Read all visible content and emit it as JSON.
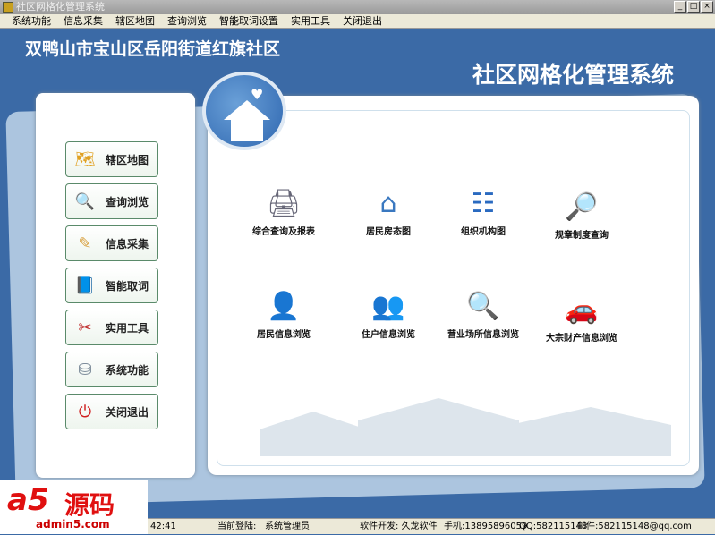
{
  "window": {
    "title": "社区网格化管理系统",
    "controls": [
      "_",
      "□",
      "×"
    ]
  },
  "menu": [
    "系统功能",
    "信息采集",
    "辖区地图",
    "查询浏览",
    "智能取词设置",
    "实用工具",
    "关闭退出"
  ],
  "header": {
    "community": "双鸭山市宝山区岳阳街道红旗社区",
    "system_title": "社区网格化管理系统"
  },
  "nav": [
    {
      "label": "辖区地图",
      "icon": "china-map-icon",
      "color": "#e0a020"
    },
    {
      "label": "查询浏览",
      "icon": "magnifier-document-icon",
      "color": "#3a7ac8"
    },
    {
      "label": "信息采集",
      "icon": "notebook-pencil-icon",
      "color": "#d8a040"
    },
    {
      "label": "智能取词",
      "icon": "book-magnifier-icon",
      "color": "#2a8a6a"
    },
    {
      "label": "实用工具",
      "icon": "tools-icon",
      "color": "#c03030"
    },
    {
      "label": "系统功能",
      "icon": "database-gear-icon",
      "color": "#708090"
    },
    {
      "label": "关闭退出",
      "icon": "power-icon",
      "color": "#d02020"
    }
  ],
  "functions": [
    {
      "label": "综合查询及报表",
      "icon": "printer-icon"
    },
    {
      "label": "居民房态图",
      "icon": "house-icon"
    },
    {
      "label": "组织机构图",
      "icon": "org-chart-icon"
    },
    {
      "label": "规章制度查询",
      "icon": "globe-magnifier-icon"
    },
    {
      "label": "居民信息浏览",
      "icon": "person-icon"
    },
    {
      "label": "住户信息浏览",
      "icon": "users-icon"
    },
    {
      "label": "营业场所信息浏览",
      "icon": "house-search-icon"
    },
    {
      "label": "大宗财产信息浏览",
      "icon": "car-icon"
    }
  ],
  "status": {
    "time": "42:41",
    "login_label": "当前登陆:",
    "user": "系统管理员",
    "developer": "软件开发: 久龙软件",
    "phone": "手机:13895896059",
    "qq": "QQ:582115148",
    "email": "邮件:582115148@qq.com"
  },
  "watermark": {
    "brand": "a5源码",
    "url": "admin5.com"
  }
}
